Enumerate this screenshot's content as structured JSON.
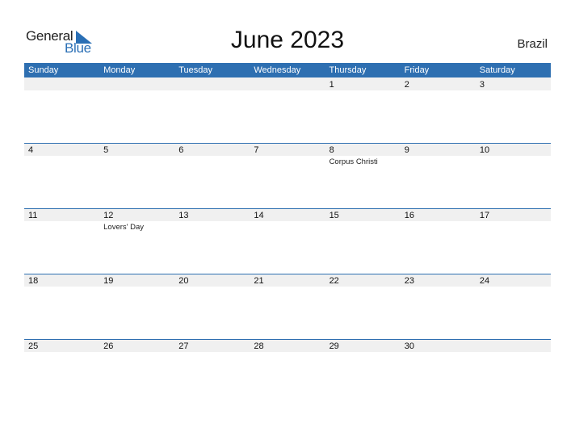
{
  "logo": {
    "part1": "General",
    "part2": "Blue",
    "accent": "#2a6fb5"
  },
  "header": {
    "title": "June 2023",
    "country": "Brazil"
  },
  "colors": {
    "header_bg": "#2e6fb1",
    "row_band": "#f0f0f0"
  },
  "weekdays": [
    "Sunday",
    "Monday",
    "Tuesday",
    "Wednesday",
    "Thursday",
    "Friday",
    "Saturday"
  ],
  "weeks": [
    [
      {
        "day": ""
      },
      {
        "day": ""
      },
      {
        "day": ""
      },
      {
        "day": ""
      },
      {
        "day": "1"
      },
      {
        "day": "2"
      },
      {
        "day": "3"
      }
    ],
    [
      {
        "day": "4"
      },
      {
        "day": "5"
      },
      {
        "day": "6"
      },
      {
        "day": "7"
      },
      {
        "day": "8",
        "holiday": "Corpus Christi"
      },
      {
        "day": "9"
      },
      {
        "day": "10"
      }
    ],
    [
      {
        "day": "11"
      },
      {
        "day": "12",
        "holiday": "Lovers' Day"
      },
      {
        "day": "13"
      },
      {
        "day": "14"
      },
      {
        "day": "15"
      },
      {
        "day": "16"
      },
      {
        "day": "17"
      }
    ],
    [
      {
        "day": "18"
      },
      {
        "day": "19"
      },
      {
        "day": "20"
      },
      {
        "day": "21"
      },
      {
        "day": "22"
      },
      {
        "day": "23"
      },
      {
        "day": "24"
      }
    ],
    [
      {
        "day": "25"
      },
      {
        "day": "26"
      },
      {
        "day": "27"
      },
      {
        "day": "28"
      },
      {
        "day": "29"
      },
      {
        "day": "30"
      },
      {
        "day": ""
      }
    ]
  ]
}
